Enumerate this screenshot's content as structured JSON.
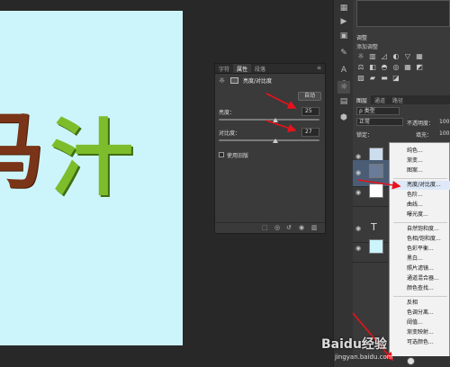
{
  "canvas": {
    "glyph_left": "马",
    "glyph_right": "汁"
  },
  "properties_panel": {
    "tabs": [
      "字符",
      "属性",
      "段落"
    ],
    "adjustment_title": "亮度/对比度",
    "auto_label": "自动",
    "brightness_label": "亮度：",
    "brightness_value": "25",
    "brightness_fraction": 0.56,
    "contrast_label": "对比度：",
    "contrast_value": "27",
    "contrast_fraction": 0.56,
    "legacy_label": "使用旧版"
  },
  "adjustments_panel": {
    "tab": "调整",
    "add_label": "添加调整",
    "icons": [
      "brightness-icon",
      "levels-icon",
      "curves-icon",
      "exposure-icon",
      "vibrance-icon",
      "hue-icon",
      "color-balance-icon",
      "bw-icon",
      "photo-filter-icon",
      "channel-mixer-icon",
      "lookup-icon",
      "invert-icon",
      "posterize-icon",
      "threshold-icon",
      "gradient-map-icon",
      "selective-color-icon"
    ]
  },
  "layers_panel": {
    "tabs": [
      "图层",
      "通道",
      "路径"
    ],
    "kind_label": "ρ 类型",
    "blend_mode": "正常",
    "opacity_label": "不透明度：",
    "opacity_value": "100",
    "lock_label": "锁定：",
    "fill_label": "填充：",
    "fill_value": "100"
  },
  "context_menu": {
    "items": [
      {
        "label": "纯色...",
        "highlight": false
      },
      {
        "label": "渐变...",
        "highlight": false
      },
      {
        "label": "图案...",
        "highlight": false
      },
      {
        "label": "亮度/对比度...",
        "highlight": true
      },
      {
        "label": "色阶...",
        "highlight": false
      },
      {
        "label": "曲线...",
        "highlight": false
      },
      {
        "label": "曝光度...",
        "highlight": false
      },
      {
        "label": "自然饱和度...",
        "highlight": false
      },
      {
        "label": "色相/饱和度...",
        "highlight": false
      },
      {
        "label": "色彩平衡...",
        "highlight": false
      },
      {
        "label": "黑白...",
        "highlight": false
      },
      {
        "label": "照片滤镜...",
        "highlight": false
      },
      {
        "label": "通道混合器...",
        "highlight": false
      },
      {
        "label": "颜色查找...",
        "highlight": false
      },
      {
        "label": "反相",
        "highlight": false
      },
      {
        "label": "色调分离...",
        "highlight": false
      },
      {
        "label": "阈值...",
        "highlight": false
      },
      {
        "label": "渐变映射...",
        "highlight": false
      },
      {
        "label": "可选颜色...",
        "highlight": false
      }
    ]
  },
  "watermark": {
    "brand": "Baidu经验",
    "url": "jingyan.baidu.com"
  },
  "colors": {
    "canvas_bg": "#ccf5fb",
    "annotation_red": "#e8121a",
    "accent_blue": "#2d6fd1"
  }
}
